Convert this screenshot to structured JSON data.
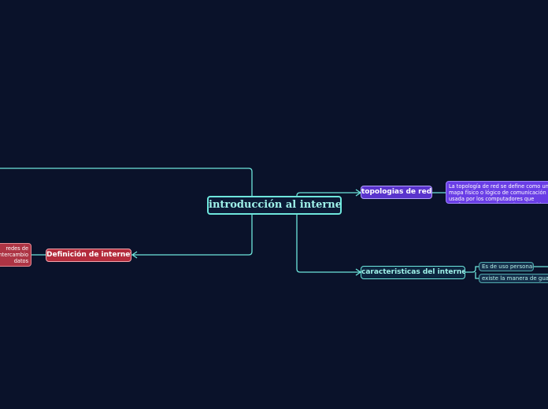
{
  "central": {
    "label": "introducción al internet"
  },
  "topologias": {
    "label": "topologias de red",
    "description": "La topología de red se define como un mapa físico o lógico de comunicación usada por los computadores que conforman una red para intercambiar datos"
  },
  "caracteristicas": {
    "label": "caracteristicas del internet",
    "items": [
      "Es de uso personal",
      "existe la manera de guardar"
    ]
  },
  "definicion": {
    "label": "Definición de internet",
    "description": "redes de intercambio datos"
  },
  "colors": {
    "background": "#0a122a",
    "connector": "#6ee6dc",
    "topologias": "#5a34cc",
    "definicion": "#b42c3c"
  }
}
